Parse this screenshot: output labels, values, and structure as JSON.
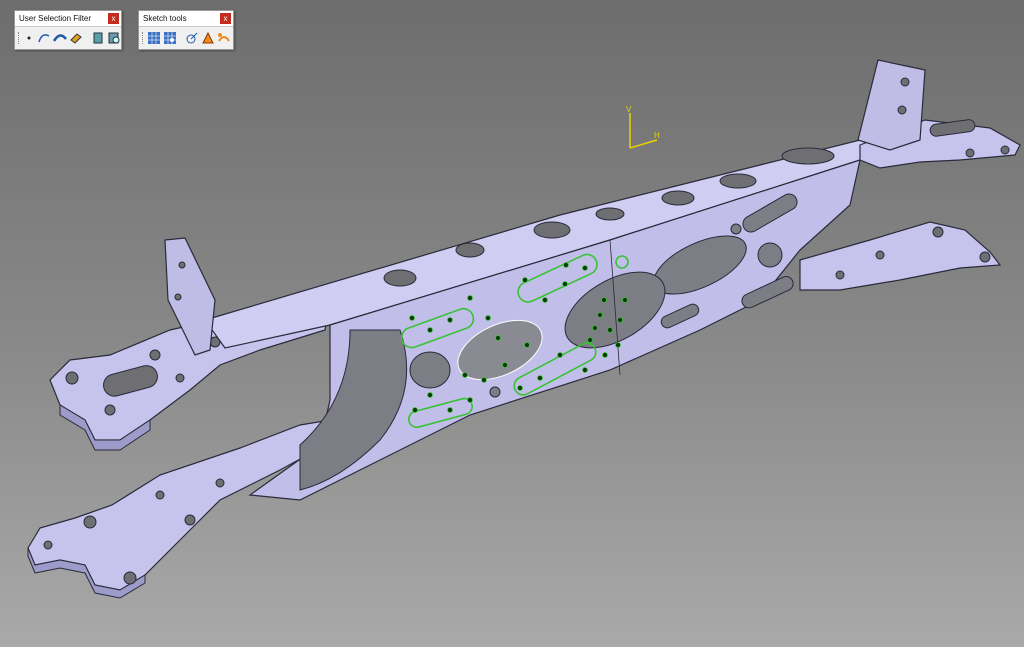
{
  "toolbars": {
    "selection_filter": {
      "title": "User Selection Filter",
      "close_label": "x",
      "icons": [
        "point-filter-icon",
        "curve-filter-icon",
        "surface-filter-icon",
        "volume-filter-icon",
        "feature-element-filter-icon",
        "intersection-filter-icon"
      ]
    },
    "sketch_tools": {
      "title": "Sketch tools",
      "close_label": "x",
      "icons": [
        "grid-icon",
        "snap-to-point-icon",
        "construction-element-icon",
        "geometric-constraints-icon",
        "dimensional-constraints-icon"
      ]
    }
  },
  "compass": {
    "v_label": "V",
    "h_label": "H",
    "color": "#e8d200"
  },
  "colors": {
    "part_face": "#c6c4ec",
    "part_face_dark": "#a8a6d6",
    "part_edge": "#2a2a3a",
    "hole": "#6f6f73",
    "sketch_green": "#39c234",
    "sketch_dark": "#0b3a0b"
  }
}
